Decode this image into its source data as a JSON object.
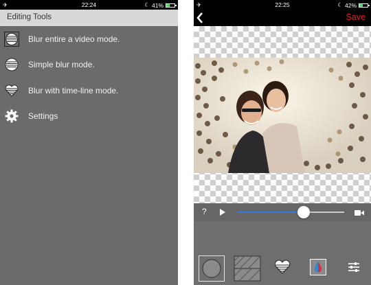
{
  "left": {
    "status": {
      "time": "22:24",
      "battery": "41%",
      "battery_level": 0.41
    },
    "header": {
      "title": "Editing Tools"
    },
    "menu": [
      {
        "label": "Blur entire a video mode.",
        "icon": "circle-lines-icon"
      },
      {
        "label": "Simple blur mode.",
        "icon": "circle-lines-icon"
      },
      {
        "label": "Blur with time-line mode.",
        "icon": "heart-lines-icon"
      },
      {
        "label": "Settings",
        "icon": "gear-icon"
      }
    ]
  },
  "right": {
    "status": {
      "time": "22:25",
      "battery": "42%",
      "battery_level": 0.42
    },
    "nav": {
      "save_label": "Save",
      "back_icon": "chevron-left-icon"
    },
    "player": {
      "help_label": "?",
      "progress": 0.62
    },
    "tools": [
      "circle-brush-icon",
      "rectangle-brush-icon",
      "heart-brush-icon",
      "blood-drop-icon",
      "sliders-icon"
    ],
    "accent": "#2f7de1",
    "save_color": "#e0212a"
  }
}
